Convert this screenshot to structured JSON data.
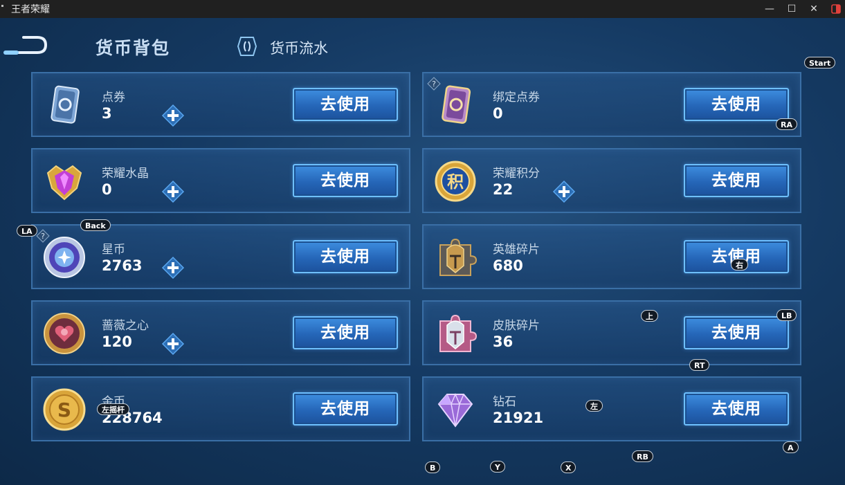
{
  "window": {
    "title": "王者荣耀",
    "minimize_glyph": "—",
    "maximize_glyph": "☐",
    "close_glyph": "✕"
  },
  "page": {
    "heading": "货币背包",
    "tab_flow_label": "货币流水"
  },
  "currencies": [
    {
      "name": "点券",
      "amount": "3",
      "use_label": "去使用",
      "has_plus": true,
      "icon": "coupon-card-icon"
    },
    {
      "name": "绑定点券",
      "amount": "0",
      "use_label": "去使用",
      "has_plus": false,
      "icon": "bound-coupon-card-icon"
    },
    {
      "name": "荣耀水晶",
      "amount": "0",
      "use_label": "去使用",
      "has_plus": true,
      "icon": "glory-crystal-icon"
    },
    {
      "name": "荣耀积分",
      "amount": "22",
      "use_label": "去使用",
      "has_plus": true,
      "icon": "glory-points-icon",
      "icon_text": "积"
    },
    {
      "name": "星币",
      "amount": "2763",
      "use_label": "去使用",
      "has_plus": true,
      "icon": "star-coin-icon"
    },
    {
      "name": "英雄碎片",
      "amount": "680",
      "use_label": "去使用",
      "has_plus": false,
      "icon": "hero-fragment-icon"
    },
    {
      "name": "蔷薇之心",
      "amount": "120",
      "use_label": "去使用",
      "has_plus": true,
      "icon": "rose-heart-icon"
    },
    {
      "name": "皮肤碎片",
      "amount": "36",
      "use_label": "去使用",
      "has_plus": false,
      "icon": "skin-fragment-icon"
    },
    {
      "name": "金币",
      "amount": "228764",
      "use_label": "去使用",
      "has_plus": false,
      "icon": "gold-coin-icon"
    },
    {
      "name": "钻石",
      "amount": "21921",
      "use_label": "去使用",
      "has_plus": false,
      "icon": "diamond-icon"
    }
  ],
  "controller_overlay": {
    "start": "Start",
    "ra": "RA",
    "back": "Back",
    "la": "LA",
    "right": "右",
    "up": "上",
    "lb": "LB",
    "rt": "RT",
    "left_stick": "左摇杆",
    "left": "左",
    "a": "A",
    "rb": "RB",
    "b": "B",
    "y": "Y",
    "x": "X"
  },
  "colors": {
    "accent": "#2f7ed6",
    "button_border": "#6ec0ff",
    "background": "#153a63"
  }
}
